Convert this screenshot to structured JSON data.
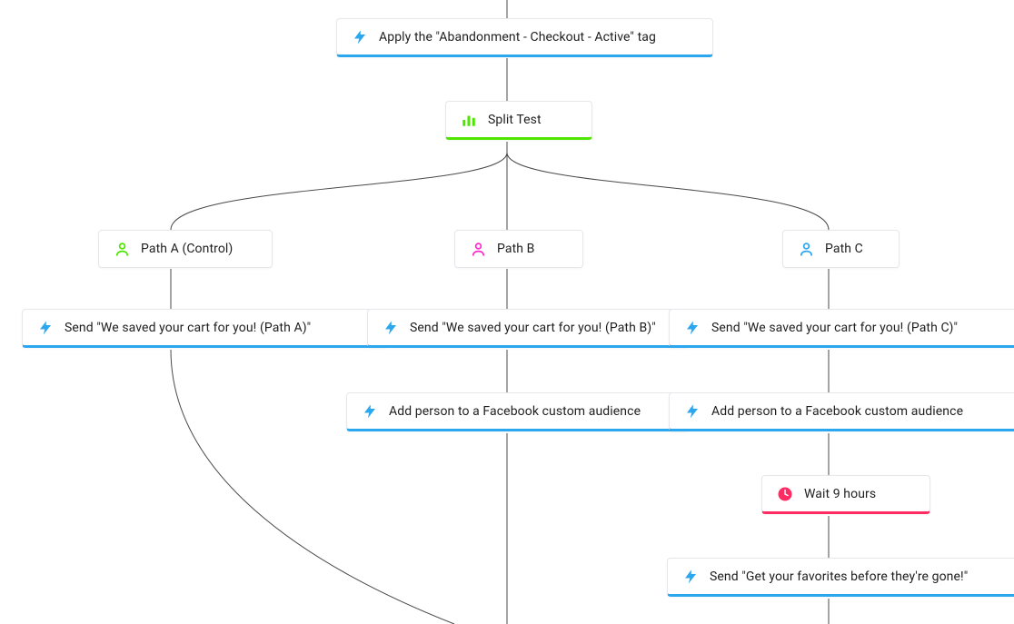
{
  "colors": {
    "action_blue": "#2ba7ef",
    "split_green": "#4ee600",
    "person_green": "#4ee600",
    "person_pink": "#ff2bd0",
    "person_blue": "#2ba7ef",
    "wait_red": "#ff2b63",
    "connector": "#4a4a4a"
  },
  "nodes": {
    "apply_tag": {
      "label": "Apply the \"Abandonment - Checkout - Active\" tag"
    },
    "split": {
      "label": "Split Test"
    },
    "path_a": {
      "label": "Path A (Control)"
    },
    "path_b": {
      "label": "Path B"
    },
    "path_c": {
      "label": "Path C"
    },
    "send_a": {
      "label": "Send \"We saved your cart for you! (Path A)\""
    },
    "send_b": {
      "label": "Send \"We saved your cart for you! (Path B)\""
    },
    "send_c": {
      "label": "Send \"We saved your cart for you! (Path C)\""
    },
    "fb_b": {
      "label": "Add person to a Facebook custom audience"
    },
    "fb_c": {
      "label": "Add person to a Facebook custom audience"
    },
    "wait_c": {
      "label": "Wait 9 hours"
    },
    "send_c2": {
      "label": "Send \"Get your favorites before they're gone!\""
    }
  }
}
